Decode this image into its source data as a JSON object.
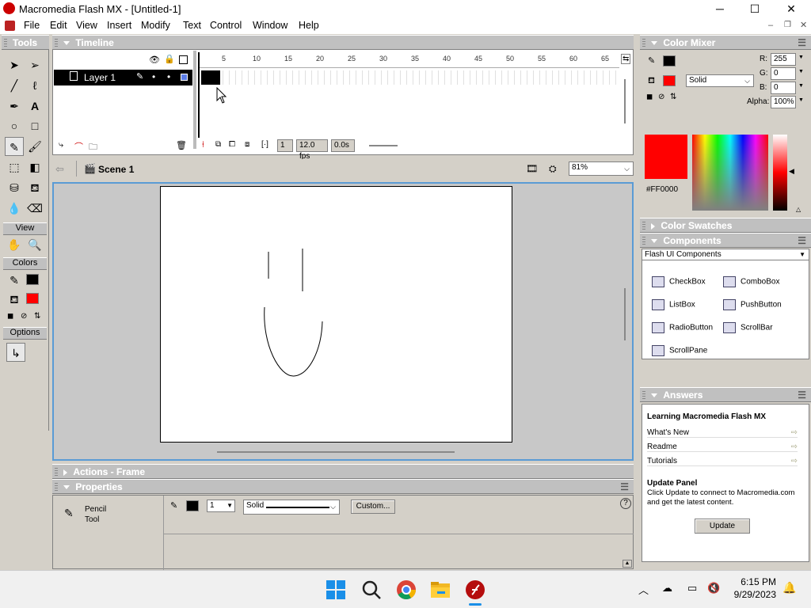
{
  "window": {
    "title": "Macromedia Flash MX - [Untitled-1]",
    "minimize": "─",
    "maximize": "☐",
    "close": "✕"
  },
  "menu": [
    "File",
    "Edit",
    "View",
    "Insert",
    "Modify",
    "Text",
    "Control",
    "Window",
    "Help"
  ],
  "toolbox": {
    "title": "Tools",
    "view_label": "View",
    "colors_label": "Colors",
    "options_label": "Options"
  },
  "timeline": {
    "title": "Timeline",
    "ruler": [
      "5",
      "10",
      "15",
      "20",
      "25",
      "30",
      "35",
      "40",
      "45",
      "50",
      "55",
      "60",
      "65"
    ],
    "layer_name": "Layer 1",
    "current_frame": "1",
    "fps": "12.0 fps",
    "elapsed": "0.0s"
  },
  "scene": {
    "name": "Scene 1",
    "zoom": "81%"
  },
  "panels": {
    "actions": "Actions - Frame",
    "properties": "Properties"
  },
  "properties": {
    "tool_line1": "Pencil",
    "tool_line2": "Tool",
    "stroke_size": "1",
    "stroke_style": "Solid",
    "custom_button": "Custom..."
  },
  "color_mixer": {
    "title": "Color Mixer",
    "fill_type": "Solid",
    "r_label": "R:",
    "r": "255",
    "g_label": "G:",
    "g": "0",
    "b_label": "B:",
    "b": "0",
    "alpha_label": "Alpha:",
    "alpha": "100%",
    "hex": "#FF0000",
    "fill_color": "#FF0000"
  },
  "swatches": {
    "title": "Color Swatches"
  },
  "components": {
    "title": "Components",
    "set": "Flash UI Components",
    "items": [
      "CheckBox",
      "ComboBox",
      "ListBox",
      "PushButton",
      "RadioButton",
      "ScrollBar",
      "ScrollPane"
    ]
  },
  "answers": {
    "title": "Answers",
    "heading": "Learning Macromedia Flash MX",
    "links": [
      "What's New",
      "Readme",
      "Tutorials"
    ],
    "update_title": "Update Panel",
    "update_text": "Click Update to connect to Macromedia.com and get the latest content.",
    "update_button": "Update"
  },
  "taskbar": {
    "time": "6:15 PM",
    "date": "9/29/2023"
  }
}
